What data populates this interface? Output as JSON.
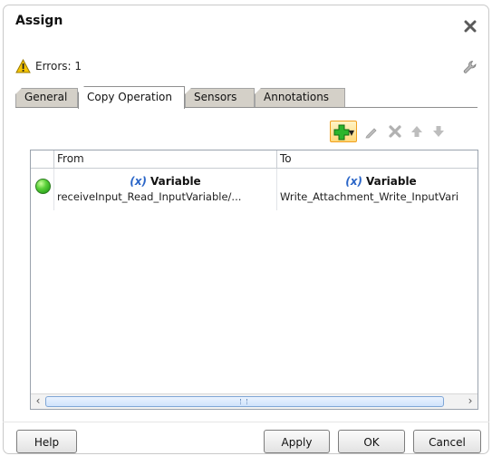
{
  "dialog": {
    "title": "Assign",
    "errors_label": "Errors: 1"
  },
  "tabs": [
    {
      "label": "General",
      "active": false
    },
    {
      "label": "Copy Operation",
      "active": true
    },
    {
      "label": "Sensors",
      "active": false
    },
    {
      "label": "Annotations",
      "active": false
    }
  ],
  "toolbar": {
    "add_icon": "add-plus-icon",
    "edit_icon": "pencil-icon",
    "delete_icon": "delete-x-icon",
    "move_up_icon": "arrow-up-icon",
    "move_down_icon": "arrow-down-icon"
  },
  "table": {
    "columns": [
      "From",
      "To"
    ],
    "rows": [
      {
        "status": "ok",
        "from": {
          "kind_icon": "(x)",
          "kind": "Variable",
          "path": "receiveInput_Read_InputVariable/..."
        },
        "to": {
          "kind_icon": "(x)",
          "kind": "Variable",
          "path": "Write_Attachment_Write_InputVari"
        }
      }
    ]
  },
  "buttons": {
    "help": "Help",
    "apply": "Apply",
    "ok": "OK",
    "cancel": "Cancel"
  },
  "colors": {
    "accent": "#f0a020",
    "warning": "#f5c400",
    "status_ok": "#2fb01e",
    "variable_icon": "#2b66c8"
  }
}
